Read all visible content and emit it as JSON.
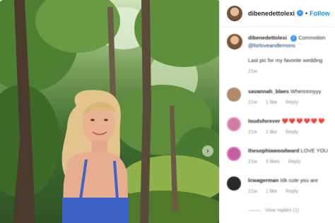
{
  "post": {
    "username": "dibenedettolexi",
    "verified_icon": "verified-badge-icon",
    "separator": "•",
    "follow_label": "Follow"
  },
  "caption": {
    "username": "dibenedettolexi",
    "text_line1": "Commotion",
    "mention": "@forloveandlemons",
    "text_line2": "Last pic for my favorite wedding",
    "time": "21w"
  },
  "comments": [
    {
      "username": "savannah_blaes",
      "text": "Whennnnyyy",
      "time": "21w",
      "likes": "1 like",
      "reply": "Reply",
      "avatar_color": "#b08a6a"
    },
    {
      "username": "loudsforever",
      "text": "❤️❤️❤️❤️❤️❤️",
      "time": "21w",
      "likes": "1 like",
      "reply": "Reply",
      "avatar_color": "#d07aa8"
    },
    {
      "username": "thesophiawoodward",
      "text": "LOVE YOU",
      "time": "21w",
      "likes": "3 likes",
      "reply": "Reply",
      "avatar_color": "#c060a0"
    },
    {
      "username": "lcwagerman",
      "text": "Idk cute you are",
      "time": "21w",
      "likes": "1 like",
      "reply": "Reply",
      "avatar_color": "#2a2a2a"
    }
  ],
  "view_replies": "View replies (1)",
  "icons": {
    "carousel_next": "chevron-right-icon",
    "comment_like": "heart-icon"
  },
  "colors": {
    "accent": "#0095f6",
    "verified": "#3897f0",
    "muted": "#8e8e8e",
    "text": "#262626"
  }
}
